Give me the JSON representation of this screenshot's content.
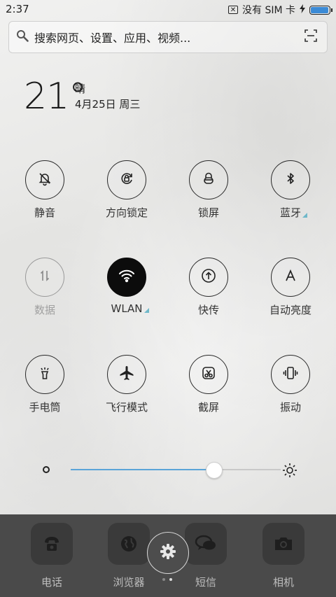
{
  "status": {
    "time": "2:37",
    "carrier": "没有 SIM 卡",
    "battery_level": 0.95
  },
  "search": {
    "placeholder": "搜索网页、设置、应用、视频..."
  },
  "weather": {
    "temperature": "21°",
    "condition": "晴",
    "date": "4月25日 周三"
  },
  "toggles": [
    {
      "label": "静音",
      "icon": "bell-off-icon",
      "state": "off"
    },
    {
      "label": "方向锁定",
      "icon": "rotation-lock-icon",
      "state": "off"
    },
    {
      "label": "锁屏",
      "icon": "lock-icon",
      "state": "off"
    },
    {
      "label": "蓝牙",
      "icon": "bluetooth-icon",
      "state": "off",
      "has_more": true
    },
    {
      "label": "数据",
      "icon": "data-arrows-icon",
      "state": "disabled"
    },
    {
      "label": "WLAN",
      "icon": "wifi-icon",
      "state": "on",
      "has_more": true
    },
    {
      "label": "快传",
      "icon": "upload-icon",
      "state": "off"
    },
    {
      "label": "自动亮度",
      "icon": "auto-brightness-icon",
      "state": "off"
    },
    {
      "label": "手电筒",
      "icon": "flashlight-icon",
      "state": "off"
    },
    {
      "label": "飞行模式",
      "icon": "airplane-icon",
      "state": "off"
    },
    {
      "label": "截屏",
      "icon": "scissors-icon",
      "state": "off"
    },
    {
      "label": "振动",
      "icon": "vibrate-icon",
      "state": "off"
    }
  ],
  "brightness": {
    "value": 0.68
  },
  "dock": {
    "apps": [
      {
        "label": "电话",
        "icon": "phone-icon"
      },
      {
        "label": "浏览器",
        "icon": "globe-icon"
      },
      {
        "label": "短信",
        "icon": "message-icon"
      },
      {
        "label": "相机",
        "icon": "camera-icon"
      }
    ],
    "page_count": 2,
    "current_page": 2
  },
  "colors": {
    "accent": "#5aa4d8",
    "active_toggle": "#0c0c0c",
    "dock_bg": "#4a4a4a",
    "battery": "#3b8bd6"
  }
}
